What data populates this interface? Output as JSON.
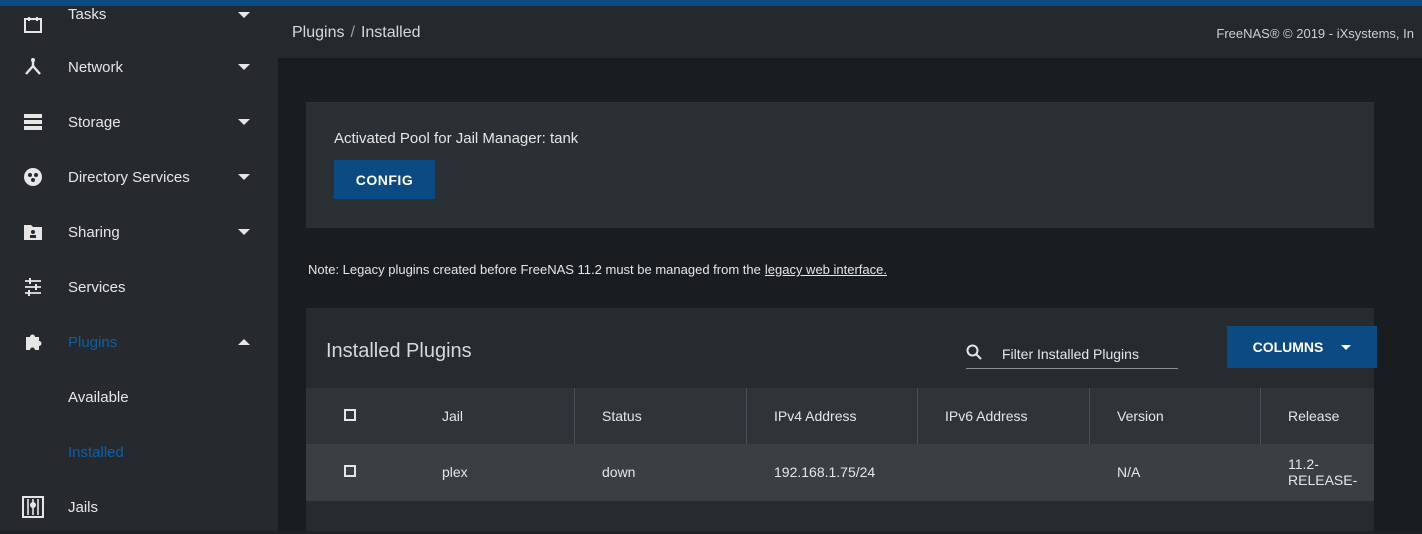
{
  "sidebar": {
    "items": [
      {
        "label": "Tasks",
        "icon": "calendar-icon",
        "chevron": "down"
      },
      {
        "label": "Network",
        "icon": "network-icon",
        "chevron": "down"
      },
      {
        "label": "Storage",
        "icon": "storage-icon",
        "chevron": "down"
      },
      {
        "label": "Directory Services",
        "icon": "directory-services-icon",
        "chevron": "down"
      },
      {
        "label": "Sharing",
        "icon": "folder-share-icon",
        "chevron": "down"
      },
      {
        "label": "Services",
        "icon": "tune-icon"
      },
      {
        "label": "Plugins",
        "icon": "puzzle-icon",
        "chevron": "up",
        "active": true
      },
      {
        "label": "Available"
      },
      {
        "label": "Installed",
        "active": true
      },
      {
        "label": "Jails",
        "icon": "jail-icon"
      }
    ]
  },
  "header": {
    "breadcrumb": [
      "Plugins",
      "Installed"
    ],
    "breadcrumb_separator": "/",
    "copyright": "FreeNAS® © 2019 - iXsystems, In"
  },
  "pool_card": {
    "text": "Activated Pool for Jail Manager: tank",
    "config_button": "CONFIG"
  },
  "note": {
    "text": "Note: Legacy plugins created before FreeNAS 11.2 must be managed from the",
    "link": "legacy web interface."
  },
  "plugins_table": {
    "title": "Installed Plugins",
    "filter_placeholder": "Filter Installed Plugins",
    "columns_button": "COLUMNS",
    "headers": [
      "Jail",
      "Status",
      "IPv4 Address",
      "IPv6 Address",
      "Version",
      "Release"
    ],
    "rows": [
      {
        "jail": "plex",
        "status": "down",
        "ipv4": "192.168.1.75/24",
        "ipv6": "",
        "version": "N/A",
        "release": "11.2-RELEASE-"
      }
    ]
  },
  "colors": {
    "accent": "#0b4a83",
    "active_nav": "#0d5fa8",
    "sidebar_bg": "#262a2e",
    "main_bg": "#1a1d20"
  }
}
